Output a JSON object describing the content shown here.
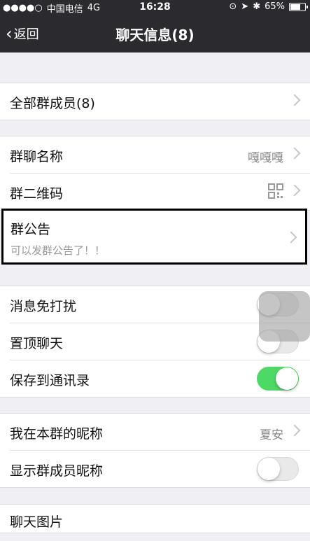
{
  "status": {
    "carrier": "中国电信",
    "network": "4G",
    "time": "16:28",
    "battery": "65%",
    "battery_level": 0.65
  },
  "nav": {
    "back_label": "返回",
    "title": "聊天信息(8)"
  },
  "members": {
    "label": "全部群成员(8)"
  },
  "group": {
    "name_label": "群聊名称",
    "name_value": "嘎嘎嘎",
    "qr_label": "群二维码"
  },
  "notice": {
    "label": "群公告",
    "sub": "可以发群公告了！！"
  },
  "settings": {
    "mute_label": "消息免打扰",
    "mute_on": false,
    "top_label": "置顶聊天",
    "top_on": false,
    "save_label": "保存到通讯录",
    "save_on": true
  },
  "nick": {
    "label": "我在本群的昵称",
    "value": "夏安"
  },
  "show_nick": {
    "label": "显示群成员昵称",
    "on": false
  },
  "partial": {
    "label": "聊天图片"
  },
  "accent": "#4cd964"
}
